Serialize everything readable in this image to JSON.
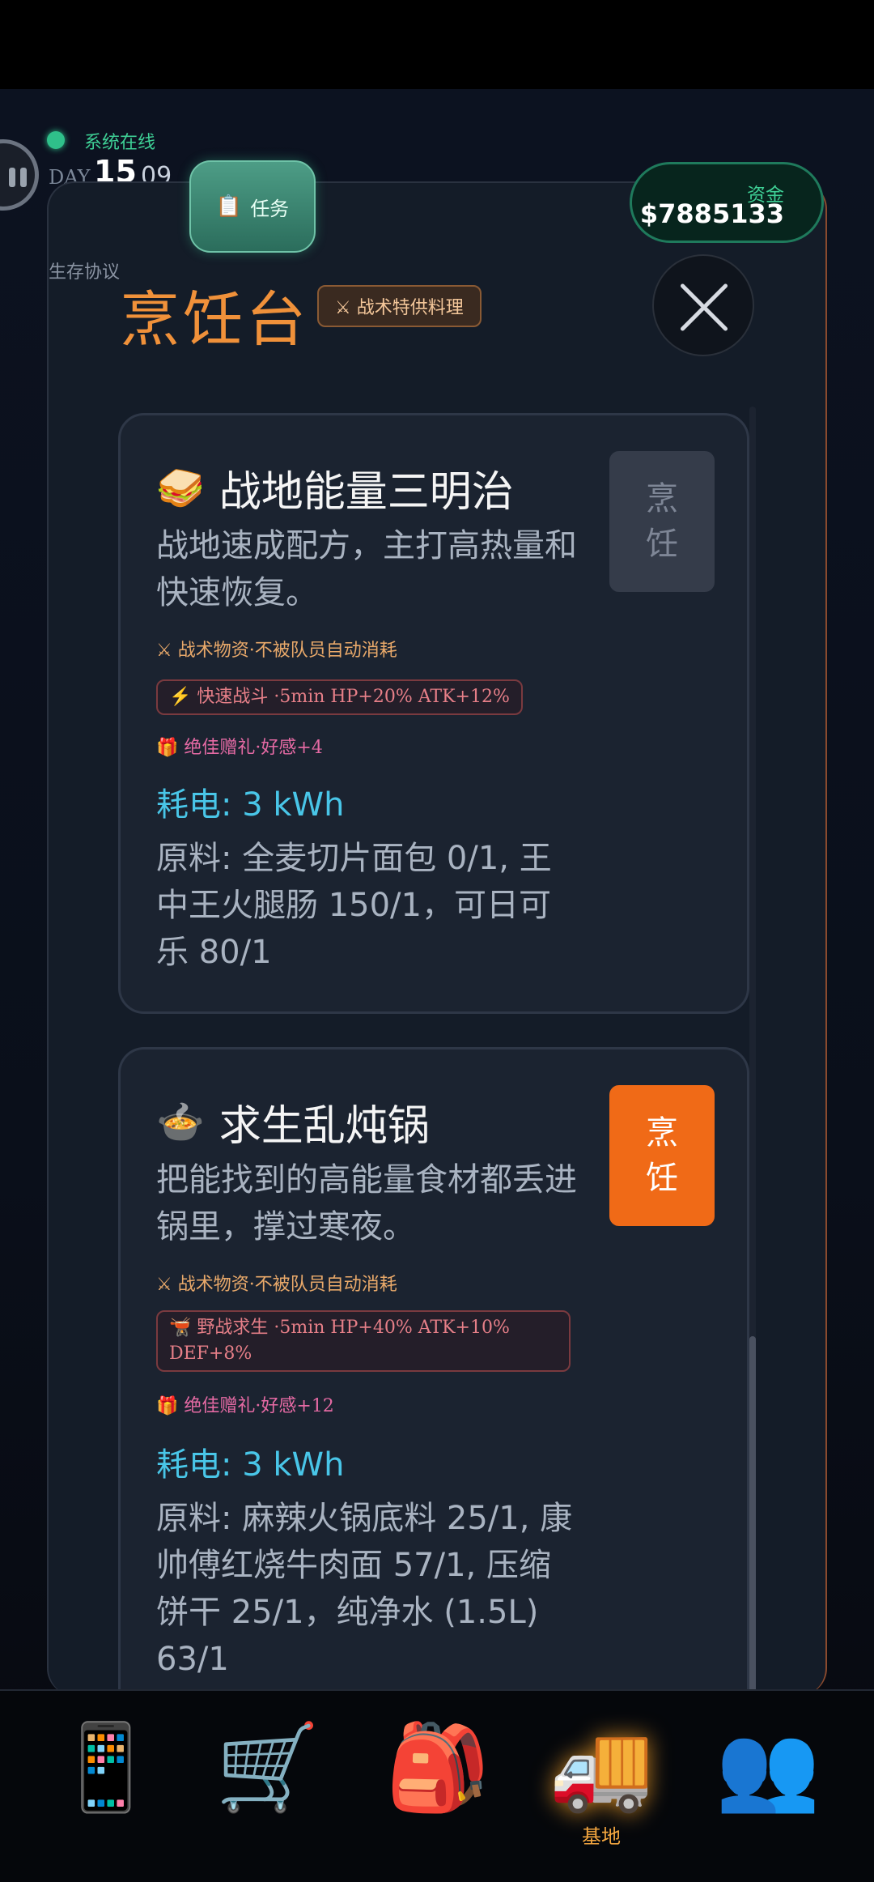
{
  "hud": {
    "status": "系统在线",
    "day_label": "DAY",
    "day_number": "15",
    "hour": "09",
    "protocol": "生存协议",
    "task_icon": "clipboard-icon",
    "task_label": "任务",
    "funds_label": "资金",
    "funds_value": "$7885133"
  },
  "panel": {
    "title": "烹饪台",
    "special_tag": "⚔ 战术特供料理"
  },
  "recipes": [
    {
      "emoji": "🥪",
      "name": "战地能量三明治",
      "description": "战地速成配方，主打高热量和快速恢复。",
      "tactical_note": "⚔ 战术物资·不被队员自动消耗",
      "buff": "⚡ 快速战斗 ·5min HP+20% ATK+12%",
      "gift": "🎁 绝佳赠礼·好感+4",
      "power": "耗电: 3 kWh",
      "ingredients": "原料: 全麦切片面包 0/1, 王中王火腿肠 150/1，可日可乐 80/1",
      "cook_label": "烹饪",
      "cook_enabled": false
    },
    {
      "emoji": "🍲",
      "name": "求生乱炖锅",
      "description": "把能找到的高能量食材都丢进锅里，撑过寒夜。",
      "tactical_note": "⚔ 战术物资·不被队员自动消耗",
      "buff": "🫕 野战求生 ·5min HP+40% ATK+10% DEF+8%",
      "gift": "🎁 绝佳赠礼·好感+12",
      "power": "耗电: 3 kWh",
      "ingredients": "原料: 麻辣火锅底料 25/1, 康帅傅红烧牛肉面 57/1, 压缩饼干 25/1，纯净水 (1.5L) 63/1",
      "cook_label": "烹饪",
      "cook_enabled": true
    }
  ],
  "bottom_nav": [
    {
      "icon": "phone-icon",
      "glyph": "📱",
      "label": ""
    },
    {
      "icon": "shopping-cart-icon",
      "glyph": "🛒",
      "label": ""
    },
    {
      "icon": "backpack-icon",
      "glyph": "🎒",
      "label": ""
    },
    {
      "icon": "truck-icon",
      "glyph": "🚚",
      "label": "基地",
      "active": true
    },
    {
      "icon": "users-icon",
      "glyph": "👥",
      "label": ""
    }
  ]
}
